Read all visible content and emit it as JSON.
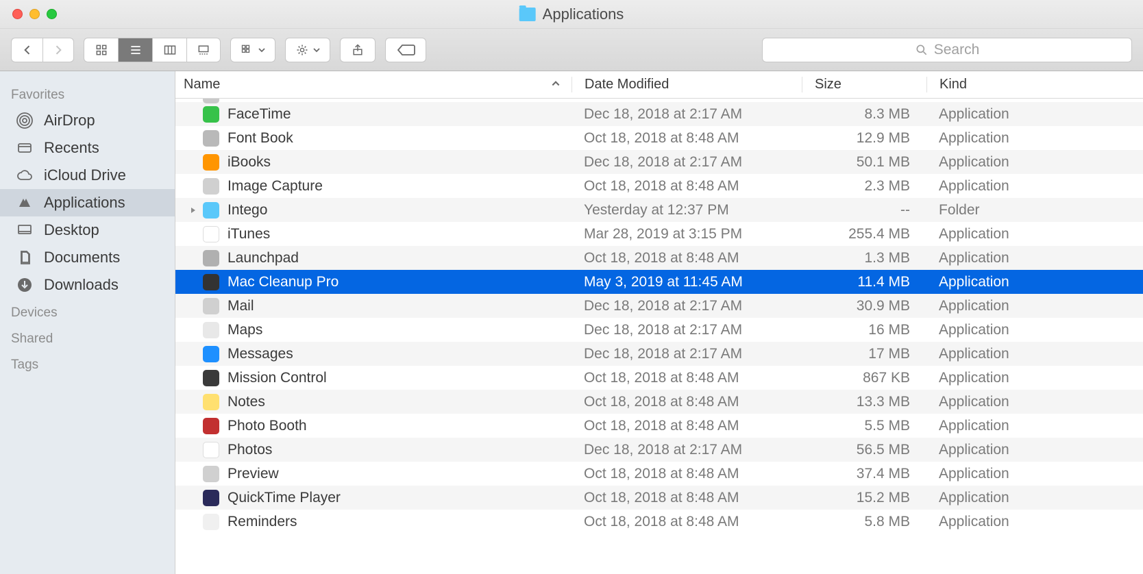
{
  "window": {
    "title": "Applications"
  },
  "toolbar": {
    "search_placeholder": "Search"
  },
  "sidebar": {
    "sections": [
      {
        "title": "Favorites",
        "items": [
          {
            "id": "airdrop",
            "label": "AirDrop"
          },
          {
            "id": "recents",
            "label": "Recents"
          },
          {
            "id": "icloud",
            "label": "iCloud Drive"
          },
          {
            "id": "apps",
            "label": "Applications",
            "selected": true
          },
          {
            "id": "desktop",
            "label": "Desktop"
          },
          {
            "id": "documents",
            "label": "Documents"
          },
          {
            "id": "downloads",
            "label": "Downloads"
          }
        ]
      },
      {
        "title": "Devices",
        "items": []
      },
      {
        "title": "Shared",
        "items": []
      },
      {
        "title": "Tags",
        "items": []
      }
    ]
  },
  "columns": {
    "name": "Name",
    "date": "Date Modified",
    "size": "Size",
    "kind": "Kind"
  },
  "rows": [
    {
      "name": "FaceTime",
      "date": "Dec 18, 2018 at 2:17 AM",
      "size": "8.3 MB",
      "kind": "Application",
      "icon_bg": "#37c24a"
    },
    {
      "name": "Font Book",
      "date": "Oct 18, 2018 at 8:48 AM",
      "size": "12.9 MB",
      "kind": "Application",
      "icon_bg": "#b9b9b9"
    },
    {
      "name": "iBooks",
      "date": "Dec 18, 2018 at 2:17 AM",
      "size": "50.1 MB",
      "kind": "Application",
      "icon_bg": "#ff9500"
    },
    {
      "name": "Image Capture",
      "date": "Oct 18, 2018 at 8:48 AM",
      "size": "2.3 MB",
      "kind": "Application",
      "icon_bg": "#d0d0d0"
    },
    {
      "name": "Intego",
      "date": "Yesterday at 12:37 PM",
      "size": "--",
      "kind": "Folder",
      "icon_bg": "#5ac8fa",
      "folder": true
    },
    {
      "name": "iTunes",
      "date": "Mar 28, 2019 at 3:15 PM",
      "size": "255.4 MB",
      "kind": "Application",
      "icon_bg": "#ffffff"
    },
    {
      "name": "Launchpad",
      "date": "Oct 18, 2018 at 8:48 AM",
      "size": "1.3 MB",
      "kind": "Application",
      "icon_bg": "#b0b0b0"
    },
    {
      "name": "Mac Cleanup Pro",
      "date": "May 3, 2019 at 11:45 AM",
      "size": "11.4 MB",
      "kind": "Application",
      "icon_bg": "#333333",
      "selected": true
    },
    {
      "name": "Mail",
      "date": "Dec 18, 2018 at 2:17 AM",
      "size": "30.9 MB",
      "kind": "Application",
      "icon_bg": "#d0d0d0"
    },
    {
      "name": "Maps",
      "date": "Dec 18, 2018 at 2:17 AM",
      "size": "16 MB",
      "kind": "Application",
      "icon_bg": "#e8e8e8"
    },
    {
      "name": "Messages",
      "date": "Dec 18, 2018 at 2:17 AM",
      "size": "17 MB",
      "kind": "Application",
      "icon_bg": "#1e90ff"
    },
    {
      "name": "Mission Control",
      "date": "Oct 18, 2018 at 8:48 AM",
      "size": "867 KB",
      "kind": "Application",
      "icon_bg": "#3a3a3a"
    },
    {
      "name": "Notes",
      "date": "Oct 18, 2018 at 8:48 AM",
      "size": "13.3 MB",
      "kind": "Application",
      "icon_bg": "#ffe070"
    },
    {
      "name": "Photo Booth",
      "date": "Oct 18, 2018 at 8:48 AM",
      "size": "5.5 MB",
      "kind": "Application",
      "icon_bg": "#c23030"
    },
    {
      "name": "Photos",
      "date": "Dec 18, 2018 at 2:17 AM",
      "size": "56.5 MB",
      "kind": "Application",
      "icon_bg": "#ffffff"
    },
    {
      "name": "Preview",
      "date": "Oct 18, 2018 at 8:48 AM",
      "size": "37.4 MB",
      "kind": "Application",
      "icon_bg": "#d0d0d0"
    },
    {
      "name": "QuickTime Player",
      "date": "Oct 18, 2018 at 8:48 AM",
      "size": "15.2 MB",
      "kind": "Application",
      "icon_bg": "#2a2a5a"
    },
    {
      "name": "Reminders",
      "date": "Oct 18, 2018 at 8:48 AM",
      "size": "5.8 MB",
      "kind": "Application",
      "icon_bg": "#f0f0f0"
    }
  ]
}
